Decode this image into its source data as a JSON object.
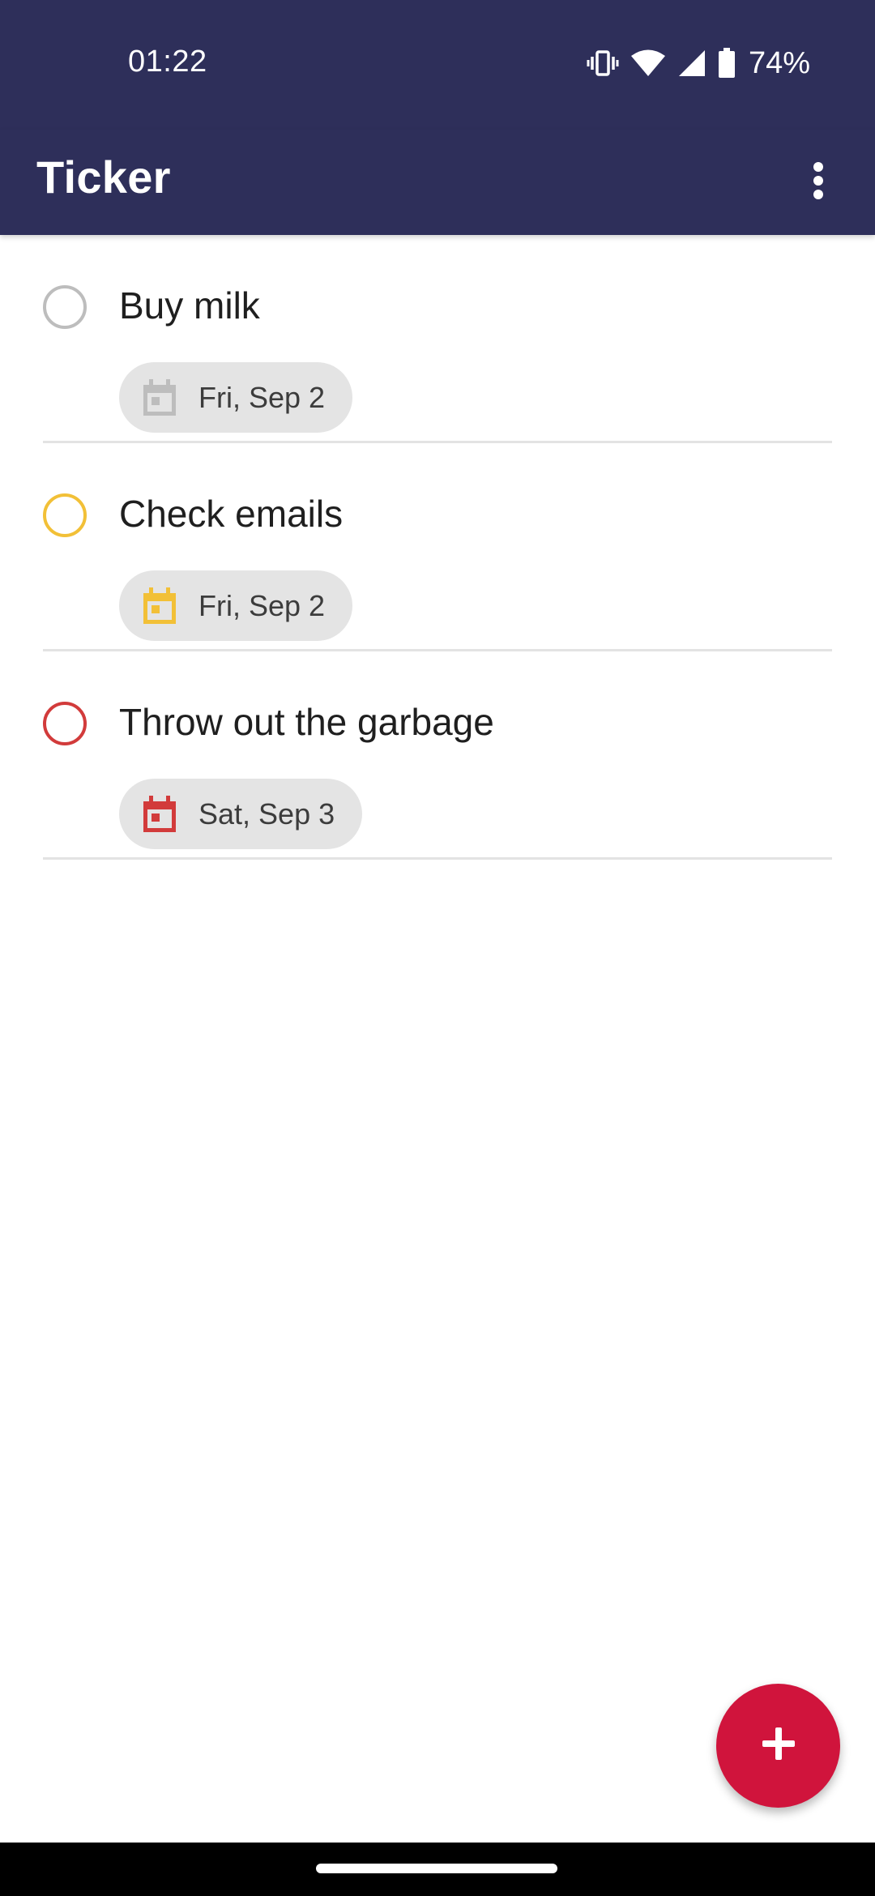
{
  "status_bar": {
    "time": "01:22",
    "battery_percent": "74%",
    "icons": [
      "vibrate-icon",
      "wifi-icon",
      "signal-icon",
      "battery-icon"
    ]
  },
  "app_bar": {
    "title": "Ticker",
    "menu_icon": "more-vert-icon"
  },
  "tasks": [
    {
      "title": "Buy milk",
      "date": "Fri, Sep 2",
      "priority_color": "#bdbdbd",
      "calendar_icon": "calendar-icon"
    },
    {
      "title": "Check emails",
      "date": "Fri, Sep 2",
      "priority_color": "#f2c037",
      "calendar_icon": "calendar-icon"
    },
    {
      "title": "Throw out the garbage",
      "date": "Sat, Sep 3",
      "priority_color": "#d23b3b",
      "calendar_icon": "calendar-icon"
    }
  ],
  "fab": {
    "icon": "plus-icon",
    "color": "#d0143c"
  },
  "colors": {
    "app_bar": "#2e2f5a",
    "chip_background": "#e4e4e4",
    "divider": "#e3e3e3"
  }
}
